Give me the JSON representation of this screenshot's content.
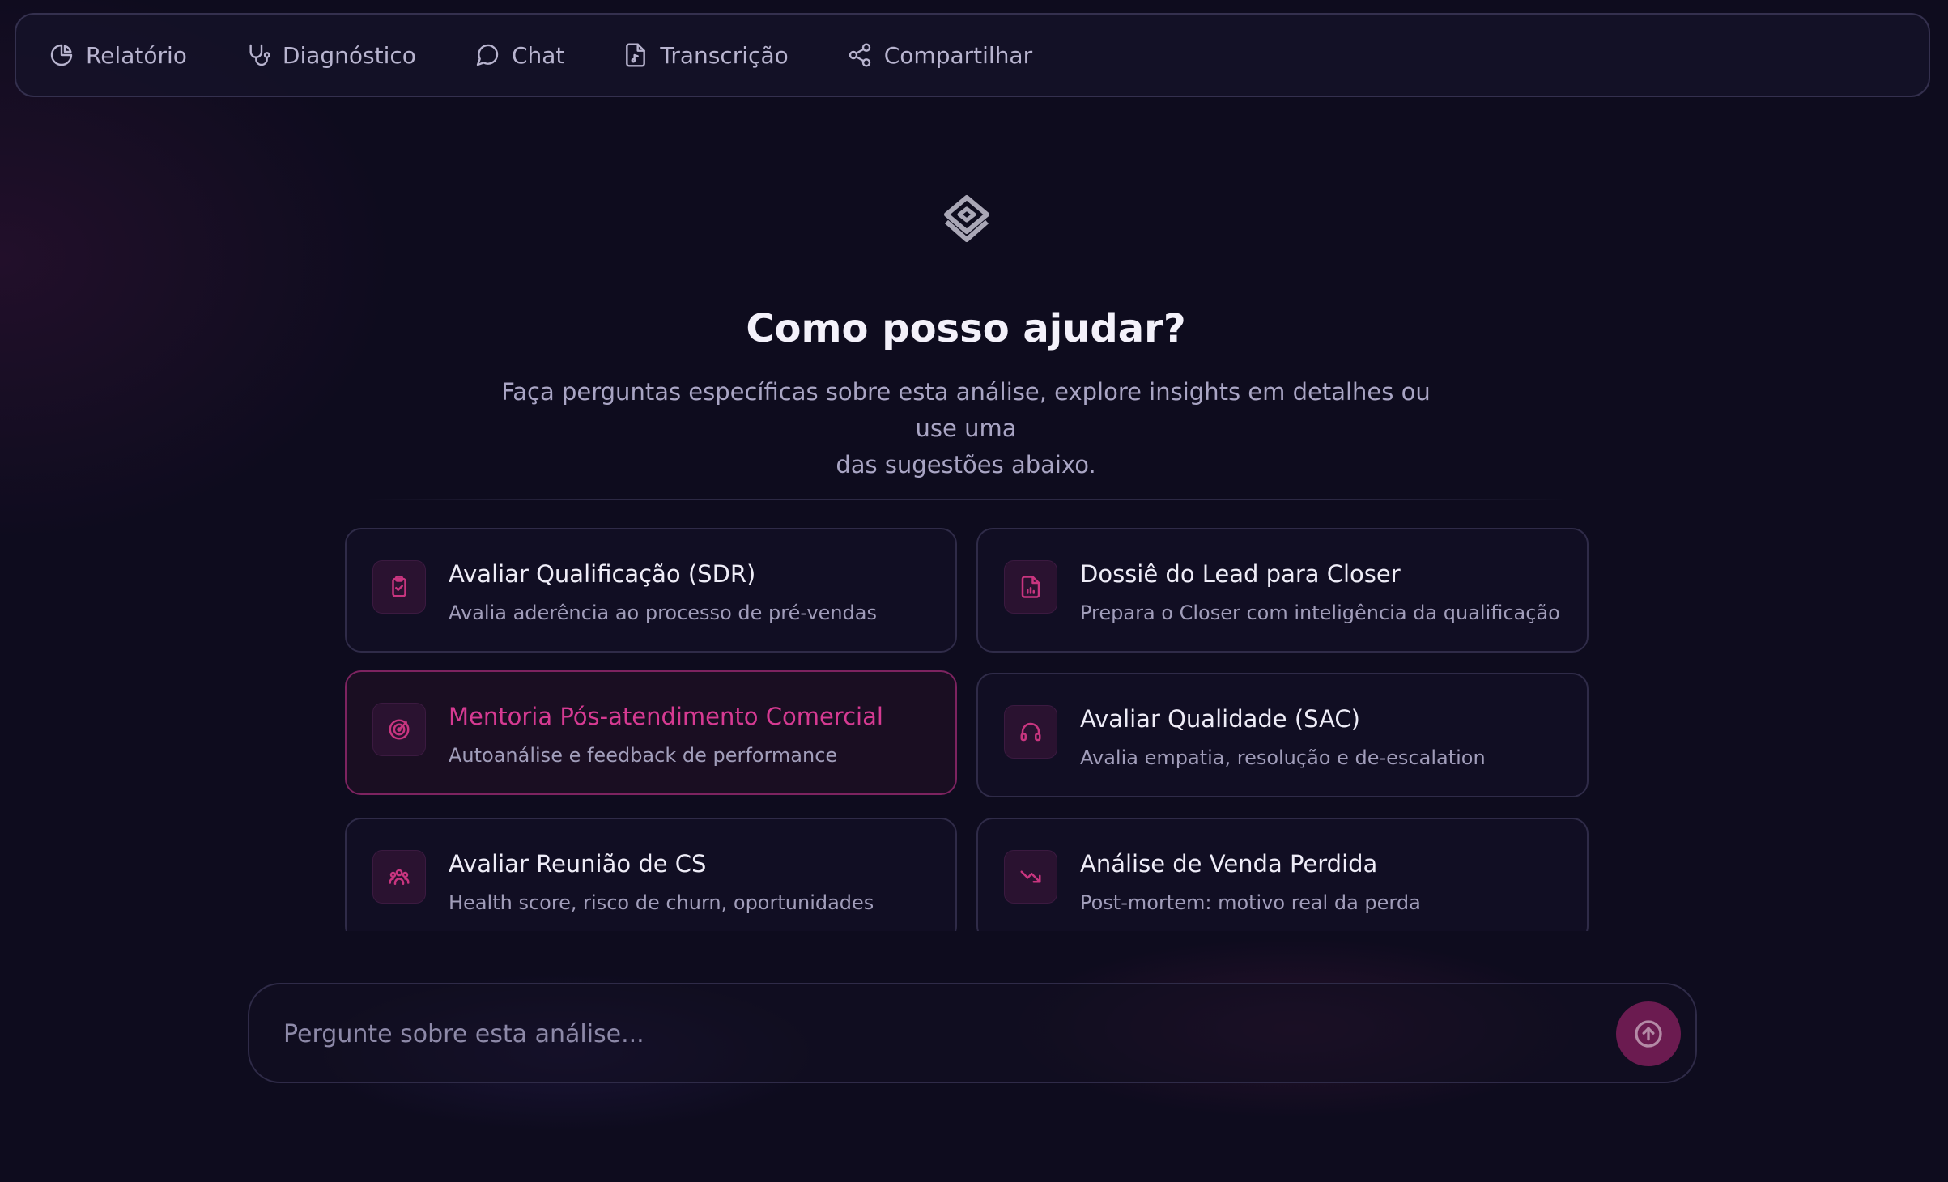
{
  "nav": {
    "tabs": [
      {
        "label": "Relatório",
        "icon": "pie-chart-icon"
      },
      {
        "label": "Diagnóstico",
        "icon": "stethoscope-icon"
      },
      {
        "label": "Chat",
        "icon": "chat-bubble-icon"
      },
      {
        "label": "Transcrição",
        "icon": "file-audio-icon"
      },
      {
        "label": "Compartilhar",
        "icon": "share-icon"
      }
    ]
  },
  "hero": {
    "logo_icon": "layered-diamond-logo",
    "title": "Como posso ajudar?",
    "subtitle_line1": "Faça perguntas específicas sobre esta análise, explore insights em detalhes ou use uma",
    "subtitle_line2": "das sugestões abaixo."
  },
  "suggestions": [
    {
      "title": "Avaliar Qualificação (SDR)",
      "description": "Avalia aderência ao processo de pré-vendas",
      "icon": "clipboard-check-icon"
    },
    {
      "title": "Dossiê do Lead para Closer",
      "description": "Prepara o Closer com inteligência da qualificação",
      "icon": "file-chart-icon"
    },
    {
      "title": "Mentoria Pós-atendimento Comercial",
      "description": "Autoanálise e feedback de performance",
      "icon": "target-icon",
      "active": true
    },
    {
      "title": "Avaliar Qualidade (SAC)",
      "description": "Avalia empatia, resolução e de-escalation",
      "icon": "headset-icon"
    },
    {
      "title": "Avaliar Reunião de CS",
      "description": "Health score, risco de churn, oportunidades",
      "icon": "users-icon"
    },
    {
      "title": "Análise de Venda Perdida",
      "description": "Post-mortem: motivo real da perda",
      "icon": "trending-down-icon"
    }
  ],
  "composer": {
    "placeholder": "Pergunte sobre esta análise...",
    "send_icon": "arrow-up-circle-icon"
  },
  "colors": {
    "background": "#0e0c1e",
    "accent": "#d63a92",
    "icon_tint": "#c8357f",
    "text_primary": "#f3f1fa",
    "text_muted": "#a9a5c4"
  }
}
